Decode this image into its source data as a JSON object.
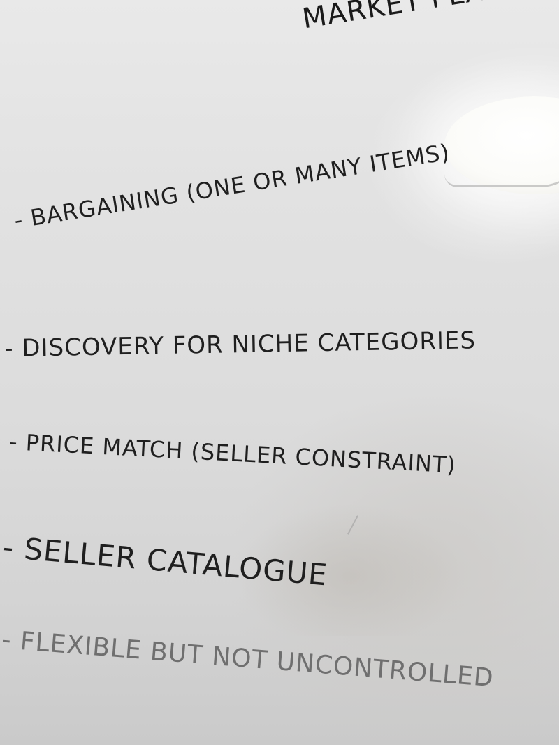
{
  "whiteboard": {
    "heading": "MARKET PLAC",
    "items": [
      "- BARGAINING (ONE OR MANY ITEMS)",
      "- DISCOVERY FOR NICHE CATEGORIES",
      "- PRICE MATCH (SELLER CONSTRAINT)",
      "- SELLER CATALOGUE",
      "- FLEXIBLE BUT NOT UNCONTROLLED"
    ],
    "marker_colors": {
      "primary": "#1f1f1f",
      "faded": "#6f6f6f"
    }
  }
}
